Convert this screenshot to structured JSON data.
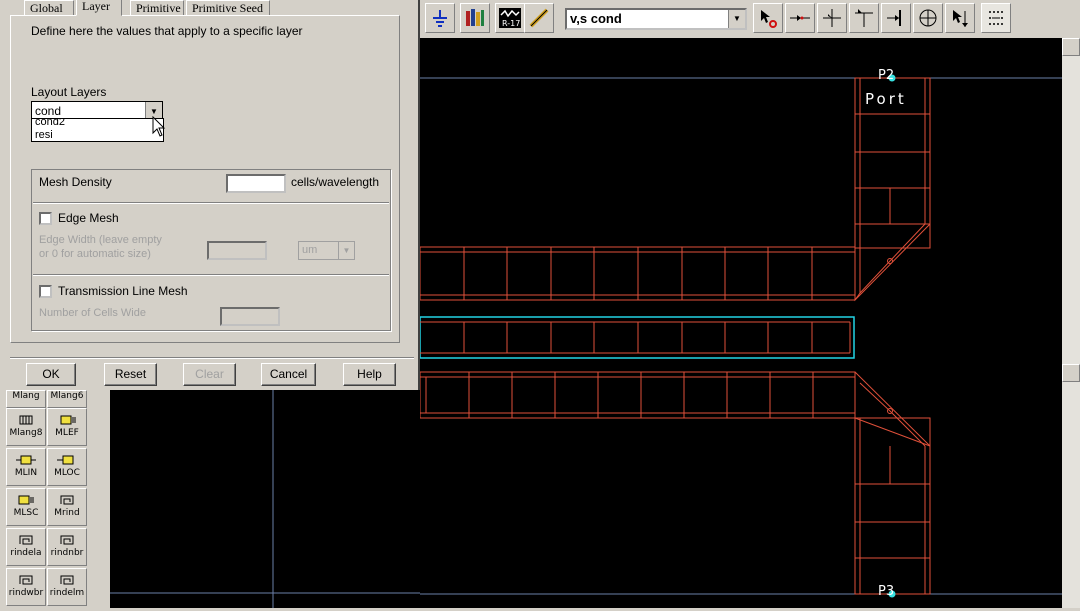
{
  "dialog": {
    "tabs": [
      "Global",
      "Layer",
      "Primitive",
      "Primitive Seed"
    ],
    "active_tab": "Layer",
    "description": "Define here the values that apply to a specific layer",
    "layout_layers_label": "Layout Layers",
    "layer_select_value": "cond",
    "layer_options": [
      "cond2",
      "resi"
    ],
    "mesh_density_label": "Mesh Density",
    "mesh_density_value": "",
    "mesh_density_unit": "cells/wavelength",
    "edge_mesh_label": "Edge Mesh",
    "edge_mesh_checked": false,
    "edge_width_label_1": "Edge Width  (leave empty",
    "edge_width_label_2": "or 0 for automatic size)",
    "edge_width_value": "",
    "edge_width_unit": "um",
    "tline_mesh_label": "Transmission Line Mesh",
    "tline_mesh_checked": false,
    "cells_wide_label": "Number of Cells Wide",
    "cells_wide_value": "",
    "buttons": {
      "ok": "OK",
      "reset": "Reset",
      "clear": "Clear",
      "cancel": "Cancel",
      "help": "Help"
    }
  },
  "toolbar": {
    "layer_combo": "v,s cond",
    "icons": [
      "ground-icon",
      "library-icon",
      "r-17-icon",
      "pencil-icon",
      "select-origin-icon",
      "insert-pin-icon",
      "cross-icon",
      "tee-icon",
      "cross-bar-icon",
      "circle-pin-icon",
      "snap-icon",
      "dots-icon"
    ]
  },
  "canvas": {
    "port_labels": [
      "P2",
      "Port",
      "P3"
    ],
    "colors": {
      "background": "#000000",
      "trace": "#e0503a",
      "selected": "#22d4e6",
      "grid": "#6a7fa8",
      "pin": "#38e2e2"
    }
  },
  "palette": {
    "items": [
      "Mlang",
      "Mlang6",
      "Mlang8",
      "MLEF",
      "MLIN",
      "MLOC",
      "MLSC",
      "Mrind",
      "rindela",
      "rindnbr",
      "rindwbr",
      "rindelm"
    ]
  }
}
